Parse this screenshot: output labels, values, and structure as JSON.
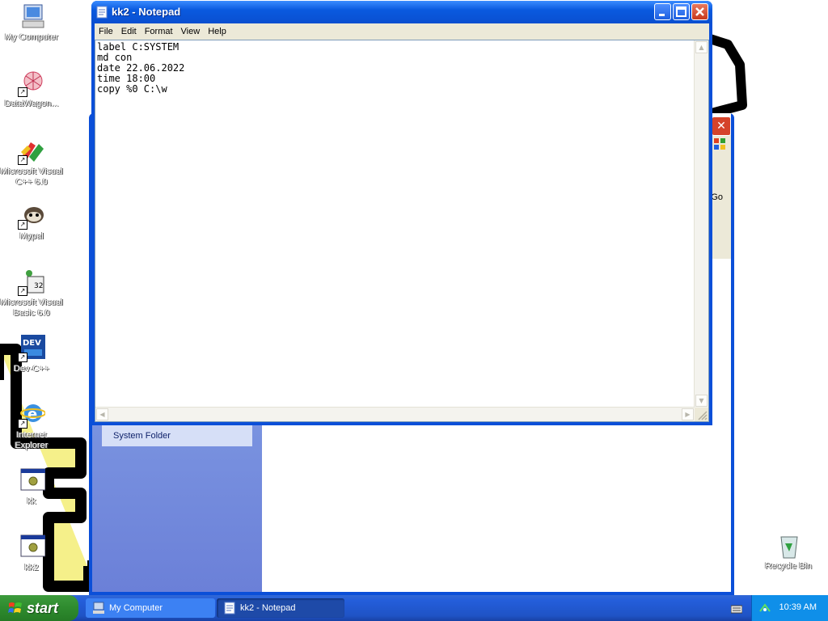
{
  "desktop": {
    "icons": [
      {
        "label": "My Computer",
        "icon": "my-computer-icon"
      },
      {
        "label": "DataWagon...",
        "icon": "datawagon-icon"
      },
      {
        "label": "Microsoft Visual C++ 6.0",
        "icon": "visual-cpp-icon"
      },
      {
        "label": "Mypal",
        "icon": "mypal-icon"
      },
      {
        "label": "Microsoft Visual Basic 6.0",
        "icon": "visual-basic-icon"
      },
      {
        "label": "Dev-C++",
        "icon": "dev-cpp-icon"
      },
      {
        "label": "Internet Explorer",
        "icon": "internet-explorer-icon"
      },
      {
        "label": "kk",
        "icon": "batch-file-icon"
      },
      {
        "label": "kk2",
        "icon": "batch-file-icon"
      }
    ],
    "recycle_bin": {
      "label": "Recycle Bin",
      "icon": "recycle-bin-icon"
    }
  },
  "background_window": {
    "title": "My Computer",
    "task_pane_item": "System Folder",
    "go_label": "Go"
  },
  "notepad": {
    "title": "kk2 - Notepad",
    "menu": [
      "File",
      "Edit",
      "Format",
      "View",
      "Help"
    ],
    "content": "label C:SYSTEM\nmd con\ndate 22.06.2022\ntime 18:00\ncopy %0 C:\\w"
  },
  "taskbar": {
    "start_label": "start",
    "tasks": [
      {
        "label": "My Computer",
        "active": false
      },
      {
        "label": "kk2 - Notepad",
        "active": true
      }
    ],
    "clock": "10:39 AM"
  },
  "colors": {
    "titlebar": "#0a5adf",
    "taskbar": "#245edb",
    "start": "#2e8b2e",
    "close_button": "#c8391c",
    "doodle_fill": "#f5f08a"
  }
}
